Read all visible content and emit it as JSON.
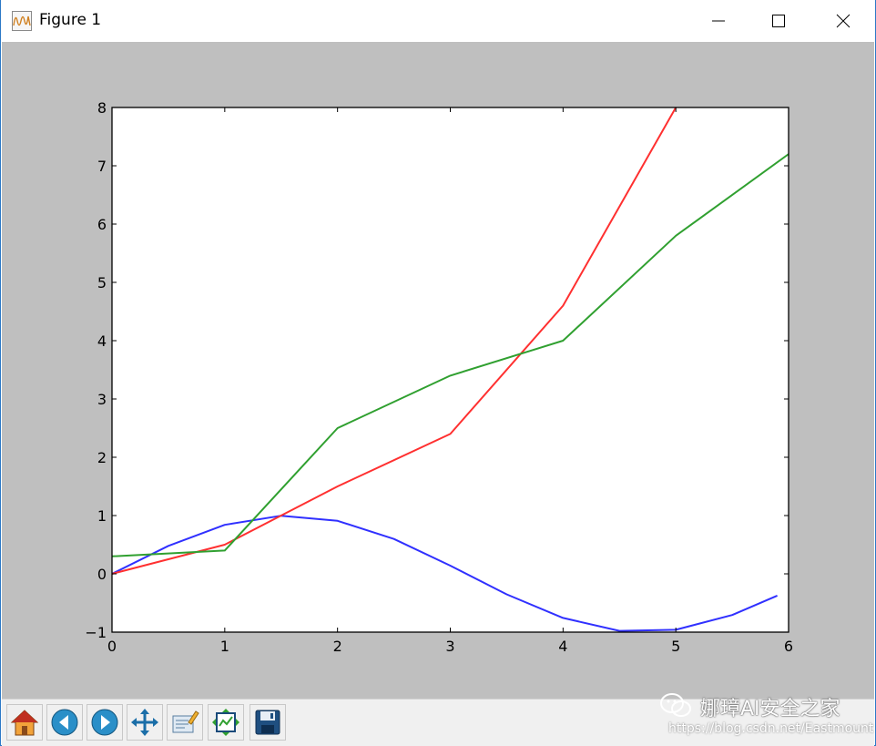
{
  "window": {
    "title": "Figure 1",
    "controls": {
      "minimize": "minimize",
      "maximize": "maximize",
      "close": "close"
    }
  },
  "icons": {
    "app": "matplotlib-figure-icon",
    "minimize": "minimize-icon",
    "maximize": "maximize-icon",
    "close": "close-icon"
  },
  "toolbar": {
    "buttons": [
      {
        "name": "home",
        "icon": "home-icon"
      },
      {
        "name": "back",
        "icon": "back-arrow-icon"
      },
      {
        "name": "forward",
        "icon": "forward-arrow-icon"
      },
      {
        "name": "pan",
        "icon": "move-icon"
      },
      {
        "name": "zoom",
        "icon": "zoom-rect-icon"
      },
      {
        "name": "subplots",
        "icon": "subplots-config-icon"
      },
      {
        "name": "save",
        "icon": "save-disk-icon"
      }
    ]
  },
  "watermark": {
    "main": "娜璋AI安全之家",
    "url": "https://blog.csdn.net/Eastmount"
  },
  "colors": {
    "figure_bg": "#bfbfbf",
    "axes_bg": "#ffffff",
    "blue": "#3030ff",
    "red": "#ff3030",
    "green": "#30a030"
  },
  "chart_data": {
    "type": "line",
    "title": "",
    "xlabel": "",
    "ylabel": "",
    "xlim": [
      0,
      6
    ],
    "ylim": [
      -1,
      8
    ],
    "xticks": [
      "0",
      "1",
      "2",
      "3",
      "4",
      "5",
      "6"
    ],
    "yticks": [
      "−1",
      "0",
      "1",
      "2",
      "3",
      "4",
      "5",
      "6",
      "7",
      "8"
    ],
    "grid": false,
    "series": [
      {
        "color": "#3030ff",
        "x": [
          0.0,
          0.5,
          1.0,
          1.5,
          2.0,
          2.5,
          3.0,
          3.5,
          4.0,
          4.5,
          5.0,
          5.5,
          5.9
        ],
        "y": [
          0.0,
          0.479,
          0.841,
          0.997,
          0.909,
          0.598,
          0.141,
          -0.351,
          -0.757,
          -0.978,
          -0.959,
          -0.706,
          -0.374
        ]
      },
      {
        "color": "#ff3030",
        "x": [
          0,
          1,
          2,
          3,
          4,
          5
        ],
        "y": [
          0.0,
          0.5,
          1.5,
          2.4,
          4.6,
          8.0
        ]
      },
      {
        "color": "#30a030",
        "x": [
          0,
          1,
          2,
          3,
          4,
          5,
          6
        ],
        "y": [
          0.3,
          0.4,
          2.5,
          3.4,
          4.0,
          5.8,
          7.2
        ]
      }
    ]
  }
}
